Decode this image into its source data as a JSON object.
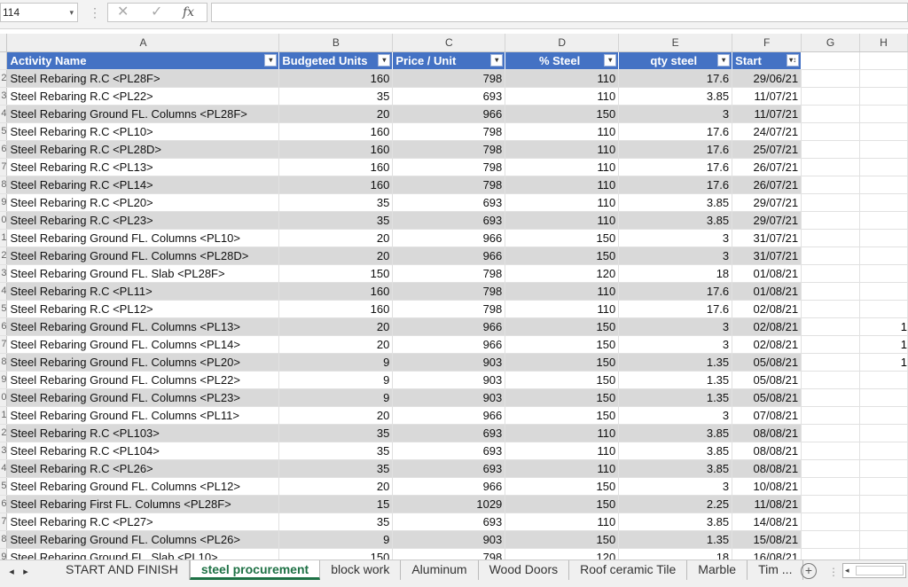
{
  "formula_bar": {
    "name_box": "114",
    "cancel_glyph": "✕",
    "enter_glyph": "✓",
    "fx_label": "fx",
    "formula_value": ""
  },
  "columns": [
    "A",
    "B",
    "C",
    "D",
    "E",
    "F",
    "G",
    "H"
  ],
  "table": {
    "headers": [
      "Activity Name",
      "Budgeted Units",
      "Price / Unit",
      "% Steel",
      "qty steel",
      "Start"
    ],
    "filter_glyph": "▾",
    "start_filter_glyph": "▾↕",
    "rows": [
      {
        "rn": "2",
        "name": "Steel Rebaring R.C  <PL28F>",
        "units": "160",
        "price": "798",
        "steel": "110",
        "qty": "17.6",
        "start": "29/06/21",
        "h": ""
      },
      {
        "rn": "3",
        "name": "Steel Rebaring R.C  <PL22>",
        "units": "35",
        "price": "693",
        "steel": "110",
        "qty": "3.85",
        "start": "11/07/21",
        "h": ""
      },
      {
        "rn": "4",
        "name": "Steel Rebaring Ground FL. Columns  <PL28F>",
        "units": "20",
        "price": "966",
        "steel": "150",
        "qty": "3",
        "start": "11/07/21",
        "h": ""
      },
      {
        "rn": "5",
        "name": "Steel Rebaring R.C  <PL10>",
        "units": "160",
        "price": "798",
        "steel": "110",
        "qty": "17.6",
        "start": "24/07/21",
        "h": ""
      },
      {
        "rn": "6",
        "name": "Steel Rebaring R.C  <PL28D>",
        "units": "160",
        "price": "798",
        "steel": "110",
        "qty": "17.6",
        "start": "25/07/21",
        "h": ""
      },
      {
        "rn": "7",
        "name": "Steel Rebaring R.C  <PL13>",
        "units": "160",
        "price": "798",
        "steel": "110",
        "qty": "17.6",
        "start": "26/07/21",
        "h": ""
      },
      {
        "rn": "8",
        "name": "Steel Rebaring R.C  <PL14>",
        "units": "160",
        "price": "798",
        "steel": "110",
        "qty": "17.6",
        "start": "26/07/21",
        "h": ""
      },
      {
        "rn": "9",
        "name": "Steel Rebaring R.C  <PL20>",
        "units": "35",
        "price": "693",
        "steel": "110",
        "qty": "3.85",
        "start": "29/07/21",
        "h": ""
      },
      {
        "rn": "0",
        "name": "Steel Rebaring R.C  <PL23>",
        "units": "35",
        "price": "693",
        "steel": "110",
        "qty": "3.85",
        "start": "29/07/21",
        "h": ""
      },
      {
        "rn": "1",
        "name": "Steel Rebaring Ground FL. Columns  <PL10>",
        "units": "20",
        "price": "966",
        "steel": "150",
        "qty": "3",
        "start": "31/07/21",
        "h": ""
      },
      {
        "rn": "2",
        "name": "Steel Rebaring Ground FL. Columns  <PL28D>",
        "units": "20",
        "price": "966",
        "steel": "150",
        "qty": "3",
        "start": "31/07/21",
        "h": ""
      },
      {
        "rn": "3",
        "name": "Steel Rebaring Ground FL. Slab  <PL28F>",
        "units": "150",
        "price": "798",
        "steel": "120",
        "qty": "18",
        "start": "01/08/21",
        "h": ""
      },
      {
        "rn": "4",
        "name": "Steel Rebaring R.C  <PL11>",
        "units": "160",
        "price": "798",
        "steel": "110",
        "qty": "17.6",
        "start": "01/08/21",
        "h": ""
      },
      {
        "rn": "5",
        "name": "Steel Rebaring R.C  <PL12>",
        "units": "160",
        "price": "798",
        "steel": "110",
        "qty": "17.6",
        "start": "02/08/21",
        "h": ""
      },
      {
        "rn": "6",
        "name": "Steel Rebaring Ground FL. Columns  <PL13>",
        "units": "20",
        "price": "966",
        "steel": "150",
        "qty": "3",
        "start": "02/08/21",
        "h": "1"
      },
      {
        "rn": "7",
        "name": "Steel Rebaring Ground FL. Columns  <PL14>",
        "units": "20",
        "price": "966",
        "steel": "150",
        "qty": "3",
        "start": "02/08/21",
        "h": "1"
      },
      {
        "rn": "8",
        "name": "Steel Rebaring Ground FL. Columns  <PL20>",
        "units": "9",
        "price": "903",
        "steel": "150",
        "qty": "1.35",
        "start": "05/08/21",
        "h": "1"
      },
      {
        "rn": "9",
        "name": "Steel Rebaring Ground FL. Columns  <PL22>",
        "units": "9",
        "price": "903",
        "steel": "150",
        "qty": "1.35",
        "start": "05/08/21",
        "h": ""
      },
      {
        "rn": "0",
        "name": "Steel Rebaring Ground FL. Columns  <PL23>",
        "units": "9",
        "price": "903",
        "steel": "150",
        "qty": "1.35",
        "start": "05/08/21",
        "h": ""
      },
      {
        "rn": "1",
        "name": "Steel Rebaring Ground FL. Columns  <PL11>",
        "units": "20",
        "price": "966",
        "steel": "150",
        "qty": "3",
        "start": "07/08/21",
        "h": ""
      },
      {
        "rn": "2",
        "name": "Steel Rebaring R.C  <PL103>",
        "units": "35",
        "price": "693",
        "steel": "110",
        "qty": "3.85",
        "start": "08/08/21",
        "h": ""
      },
      {
        "rn": "3",
        "name": "Steel Rebaring R.C  <PL104>",
        "units": "35",
        "price": "693",
        "steel": "110",
        "qty": "3.85",
        "start": "08/08/21",
        "h": ""
      },
      {
        "rn": "4",
        "name": "Steel Rebaring R.C  <PL26>",
        "units": "35",
        "price": "693",
        "steel": "110",
        "qty": "3.85",
        "start": "08/08/21",
        "h": ""
      },
      {
        "rn": "5",
        "name": "Steel Rebaring Ground FL. Columns  <PL12>",
        "units": "20",
        "price": "966",
        "steel": "150",
        "qty": "3",
        "start": "10/08/21",
        "h": ""
      },
      {
        "rn": "6",
        "name": "Steel Rebaring First FL. Columns  <PL28F>",
        "units": "15",
        "price": "1029",
        "steel": "150",
        "qty": "2.25",
        "start": "11/08/21",
        "h": ""
      },
      {
        "rn": "7",
        "name": "Steel Rebaring R.C  <PL27>",
        "units": "35",
        "price": "693",
        "steel": "110",
        "qty": "3.85",
        "start": "14/08/21",
        "h": ""
      },
      {
        "rn": "8",
        "name": "Steel Rebaring Ground FL. Columns  <PL26>",
        "units": "9",
        "price": "903",
        "steel": "150",
        "qty": "1.35",
        "start": "15/08/21",
        "h": ""
      },
      {
        "rn": "9",
        "name": "Steel Rebaring Ground FL. Slab  <PL10>",
        "units": "150",
        "price": "798",
        "steel": "120",
        "qty": "18",
        "start": "16/08/21",
        "h": ""
      }
    ]
  },
  "sheet_tabs": {
    "nav_prev": "◂",
    "nav_next": "▸",
    "tabs": [
      "START AND FINISH",
      "steel procurement",
      "block work",
      "Aluminum",
      "Wood Doors",
      "Roof ceramic Tile",
      "Marble",
      "Tim ..."
    ],
    "active_index": 1,
    "add_glyph": "+",
    "scroll_left_glyph": "◂"
  },
  "colors": {
    "header_fill": "#4472c4",
    "band_fill": "#d9d9d9",
    "active_tab_text": "#1e7145"
  }
}
